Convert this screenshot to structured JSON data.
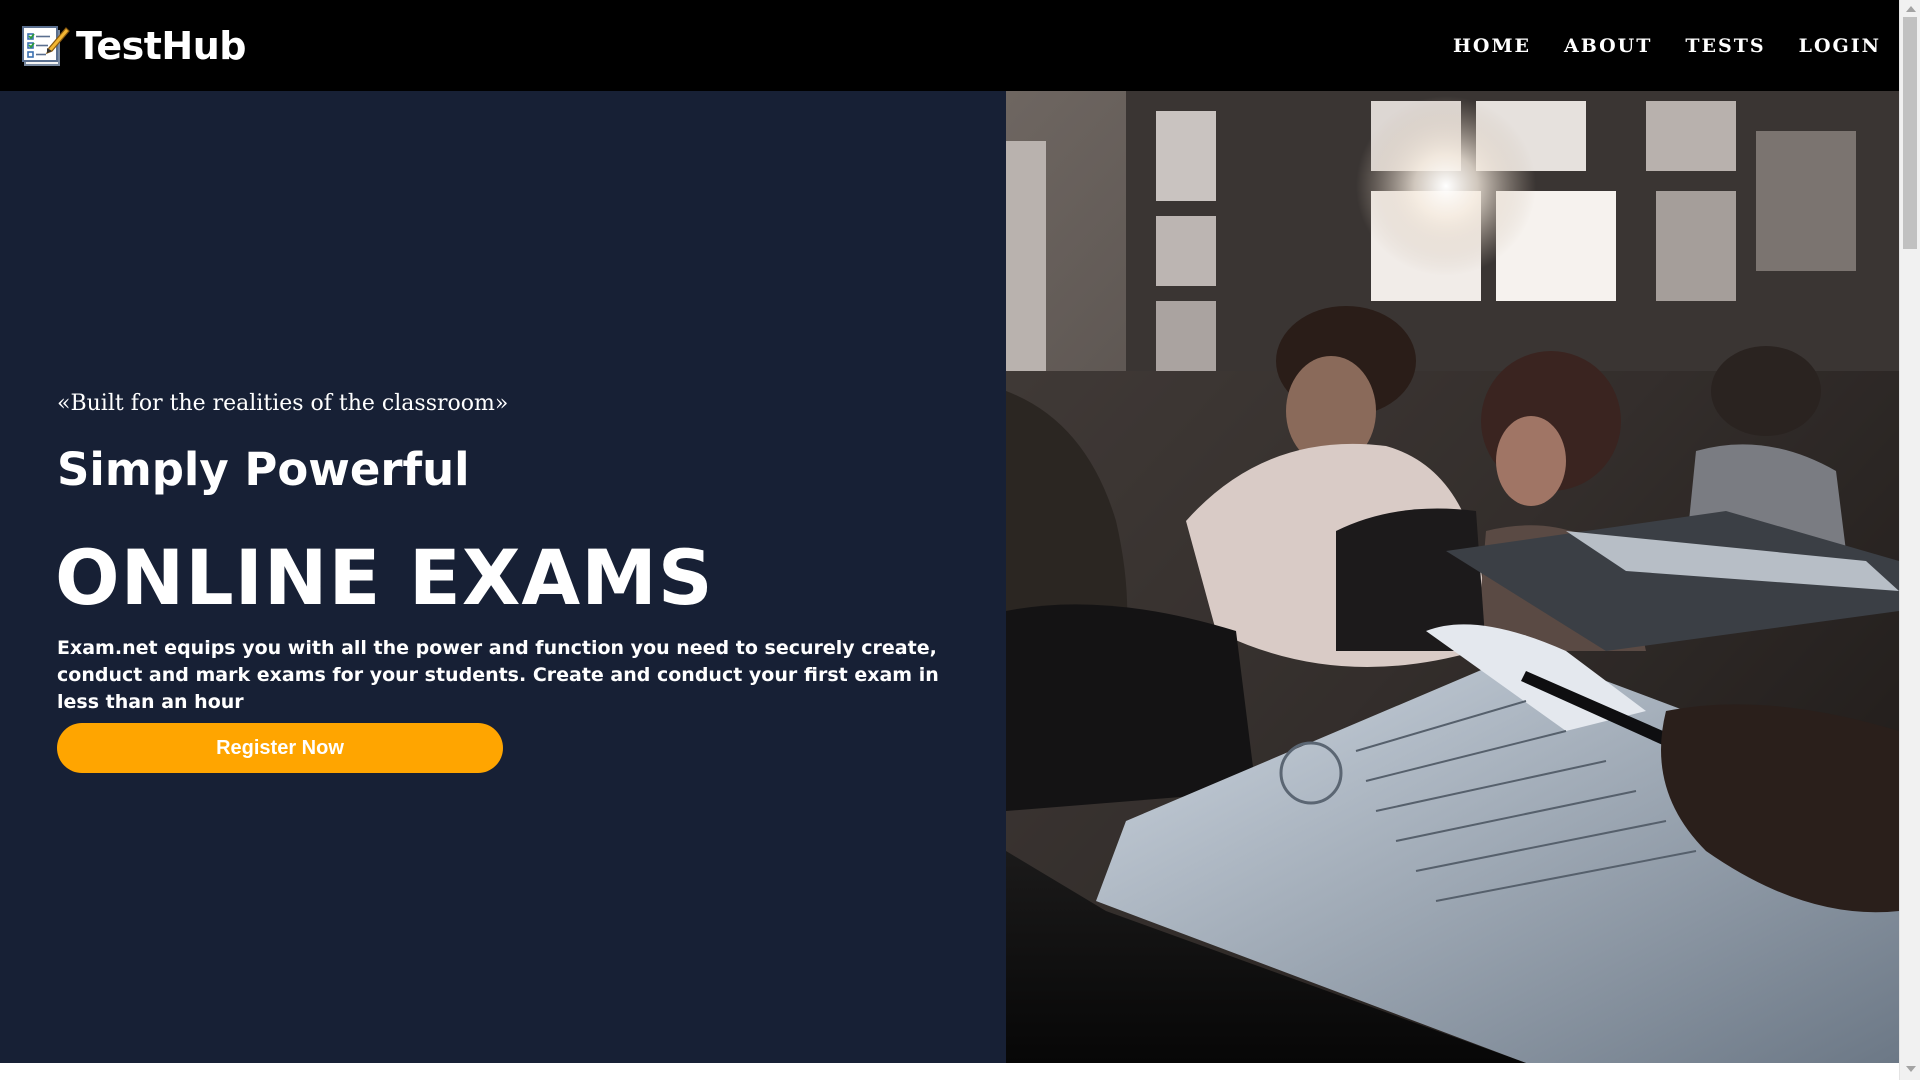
{
  "navbar": {
    "brand": "TestHub",
    "links": [
      "HOME",
      "ABOUT",
      "TESTS",
      "LOGIN"
    ]
  },
  "hero": {
    "tagline": "«Built for the realities of the classroom»",
    "subtitle": "Simply Powerful",
    "headline": "ONLINE EXAMS",
    "description": "Exam.net equips you with all the power and function you need to securely create, conduct and mark exams for your students. Create and conduct your first exam in less than an hour",
    "cta_label": "Register Now"
  },
  "colors": {
    "navbar_bg": "#000000",
    "hero_left_bg": "#172035",
    "cta_bg": "#ffa500",
    "text": "#ffffff"
  },
  "icons": {
    "brand": "exam-checklist-icon"
  }
}
